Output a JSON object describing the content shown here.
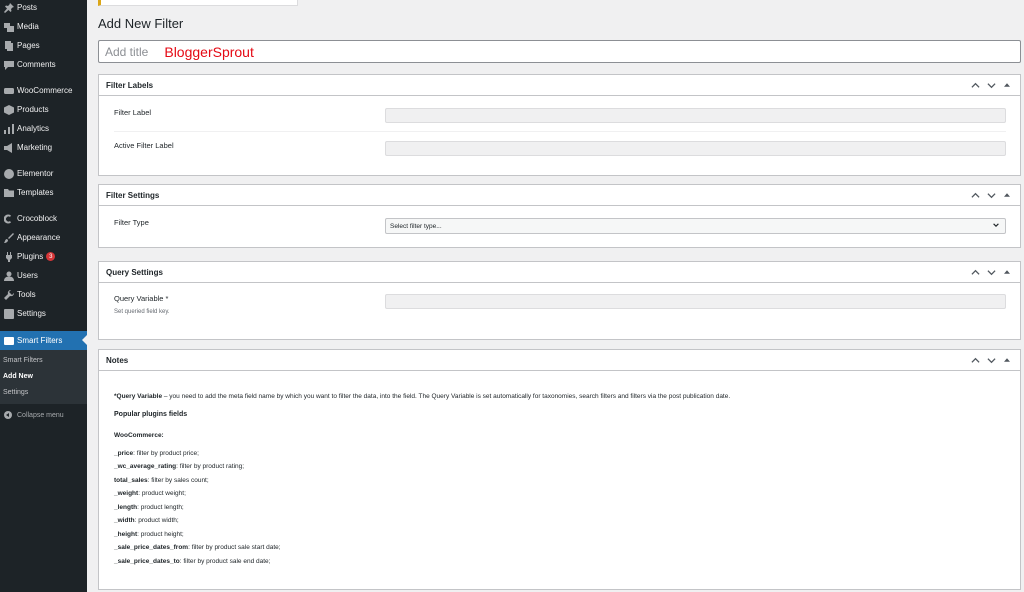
{
  "sidebar": {
    "items": [
      {
        "label": "Posts",
        "icon": "pin-icon"
      },
      {
        "label": "Media",
        "icon": "media-icon"
      },
      {
        "label": "Pages",
        "icon": "pages-icon"
      },
      {
        "label": "Comments",
        "icon": "comment-icon"
      },
      {
        "label": "WooCommerce",
        "icon": "woocommerce-icon"
      },
      {
        "label": "Products",
        "icon": "products-icon"
      },
      {
        "label": "Analytics",
        "icon": "analytics-icon"
      },
      {
        "label": "Marketing",
        "icon": "megaphone-icon"
      },
      {
        "label": "Elementor",
        "icon": "elementor-icon"
      },
      {
        "label": "Templates",
        "icon": "folder-icon"
      },
      {
        "label": "Crocoblock",
        "icon": "crocoblock-icon"
      },
      {
        "label": "Appearance",
        "icon": "brush-icon"
      },
      {
        "label": "Plugins",
        "icon": "plugin-icon",
        "badge": "3"
      },
      {
        "label": "Users",
        "icon": "users-icon"
      },
      {
        "label": "Tools",
        "icon": "wrench-icon"
      },
      {
        "label": "Settings",
        "icon": "settings-icon"
      },
      {
        "label": "Smart Filters",
        "icon": "smart-filters-icon"
      }
    ],
    "submenu": [
      "Smart Filters",
      "Add New",
      "Settings"
    ],
    "collapse_label": "Collapse menu",
    "colors": {
      "bg": "#1d2327",
      "active": "#2271b1",
      "badge": "#d63638"
    }
  },
  "page": {
    "title": "Add New Filter",
    "title_placeholder": "Add title",
    "brand_overlay": "BloggerSprout",
    "brand_color": "#e50914"
  },
  "boxes": {
    "filter_labels": {
      "title": "Filter Labels",
      "fields": [
        "Filter Label",
        "Active Filter Label"
      ]
    },
    "filter_settings": {
      "title": "Filter Settings",
      "field": "Filter Type",
      "select_value": "Select filter type..."
    },
    "query_settings": {
      "title": "Query Settings",
      "field": "Query Variable *",
      "desc": "Set queried field key."
    },
    "notes": {
      "title": "Notes",
      "intro_bold": "*Query Variable",
      "intro_rest": " – you need to add the meta field name by which you want to filter the data, into the field. The Query Variable is set automatically for taxonomies, search filters and filters via the post publication date.",
      "popular": "Popular plugins fields",
      "woo": "WooCommerce:",
      "items": [
        {
          "key": "_price",
          "text": ": filter by product price;"
        },
        {
          "key": "_wc_average_rating",
          "text": ": filter by product rating;"
        },
        {
          "key": "total_sales",
          "text": ": filter by sales count;"
        },
        {
          "key": "_weight",
          "text": ": product weight;"
        },
        {
          "key": "_length",
          "text": ": product length;"
        },
        {
          "key": "_width",
          "text": ": product width;"
        },
        {
          "key": "_height",
          "text": ": product height;"
        },
        {
          "key": "_sale_price_dates_from",
          "text": ": filter by product sale start date;"
        },
        {
          "key": "_sale_price_dates_to",
          "text": ": filter by product sale end date;"
        }
      ]
    }
  }
}
